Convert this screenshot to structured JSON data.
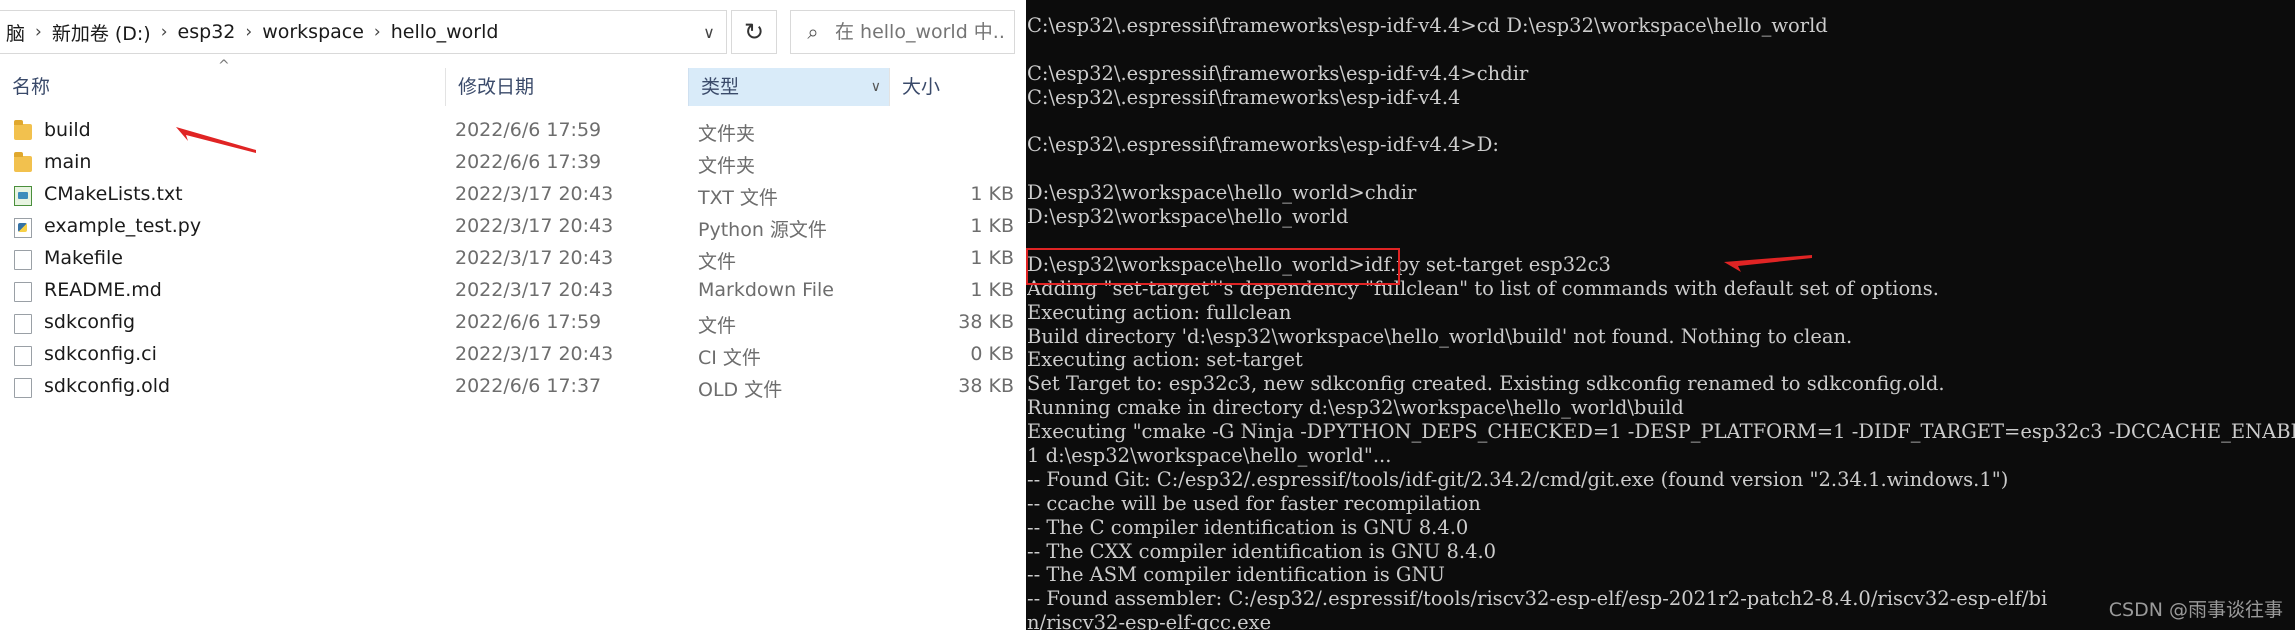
{
  "explorer": {
    "breadcrumb": [
      "脑",
      "新加卷 (D:)",
      "esp32",
      "workspace",
      "hello_world"
    ],
    "search_placeholder": "在 hello_world 中...",
    "columns": {
      "name": "名称",
      "date": "修改日期",
      "type": "类型",
      "size": "大小"
    },
    "files": [
      {
        "name": "build",
        "date": "2022/6/6 17:59",
        "type": "文件夹",
        "size": "",
        "icon": "folder-icon"
      },
      {
        "name": "main",
        "date": "2022/6/6 17:39",
        "type": "文件夹",
        "size": "",
        "icon": "folder-icon"
      },
      {
        "name": "CMakeLists.txt",
        "date": "2022/3/17 20:43",
        "type": "TXT 文件",
        "size": "1 KB",
        "icon": "cmake-file-icon"
      },
      {
        "name": "example_test.py",
        "date": "2022/3/17 20:43",
        "type": "Python 源文件",
        "size": "1 KB",
        "icon": "python-file-icon"
      },
      {
        "name": "Makefile",
        "date": "2022/3/17 20:43",
        "type": "文件",
        "size": "1 KB",
        "icon": "file-icon"
      },
      {
        "name": "README.md",
        "date": "2022/3/17 20:43",
        "type": "Markdown File",
        "size": "1 KB",
        "icon": "file-icon"
      },
      {
        "name": "sdkconfig",
        "date": "2022/6/6 17:59",
        "type": "文件",
        "size": "38 KB",
        "icon": "file-icon"
      },
      {
        "name": "sdkconfig.ci",
        "date": "2022/3/17 20:43",
        "type": "CI 文件",
        "size": "0 KB",
        "icon": "file-icon"
      },
      {
        "name": "sdkconfig.old",
        "date": "2022/6/6 17:37",
        "type": "OLD 文件",
        "size": "38 KB",
        "icon": "file-icon"
      }
    ]
  },
  "console": {
    "lines": [
      "C:\\esp32\\.espressif\\frameworks\\esp-idf-v4.4>cd D:\\esp32\\workspace\\hello_world",
      "",
      "C:\\esp32\\.espressif\\frameworks\\esp-idf-v4.4>chdir",
      "C:\\esp32\\.espressif\\frameworks\\esp-idf-v4.4",
      "",
      "C:\\esp32\\.espressif\\frameworks\\esp-idf-v4.4>D:",
      "",
      "D:\\esp32\\workspace\\hello_world>chdir",
      "D:\\esp32\\workspace\\hello_world",
      "",
      "D:\\esp32\\workspace\\hello_world>idf.py set-target esp32c3",
      "Adding \"set-target\"'s dependency \"fullclean\" to list of commands with default set of options.",
      "Executing action: fullclean",
      "Build directory 'd:\\esp32\\workspace\\hello_world\\build' not found. Nothing to clean.",
      "Executing action: set-target",
      "Set Target to: esp32c3, new sdkconfig created. Existing sdkconfig renamed to sdkconfig.old.",
      "Running cmake in directory d:\\esp32\\workspace\\hello_world\\build",
      "Executing \"cmake -G Ninja -DPYTHON_DEPS_CHECKED=1 -DESP_PLATFORM=1 -DIDF_TARGET=esp32c3 -DCCACHE_ENABLE=",
      "1 d:\\esp32\\workspace\\hello_world\"...",
      "-- Found Git: C:/esp32/.espressif/tools/idf-git/2.34.2/cmd/git.exe (found version \"2.34.1.windows.1\")",
      "-- ccache will be used for faster recompilation",
      "-- The C compiler identification is GNU 8.4.0",
      "-- The CXX compiler identification is GNU 8.4.0",
      "-- The ASM compiler identification is GNU",
      "-- Found assembler: C:/esp32/.espressif/tools/riscv32-esp-elf/esp-2021r2-patch2-8.4.0/riscv32-esp-elf/bi",
      "n/riscv32-esp-elf-gcc.exe"
    ],
    "watermark": "CSDN @雨事谈往事"
  },
  "colors": {
    "annotation": "#e02424",
    "console_bg": "#0c0c0c",
    "console_fg": "#cccccc",
    "header_selected": "#d9ebf9"
  }
}
